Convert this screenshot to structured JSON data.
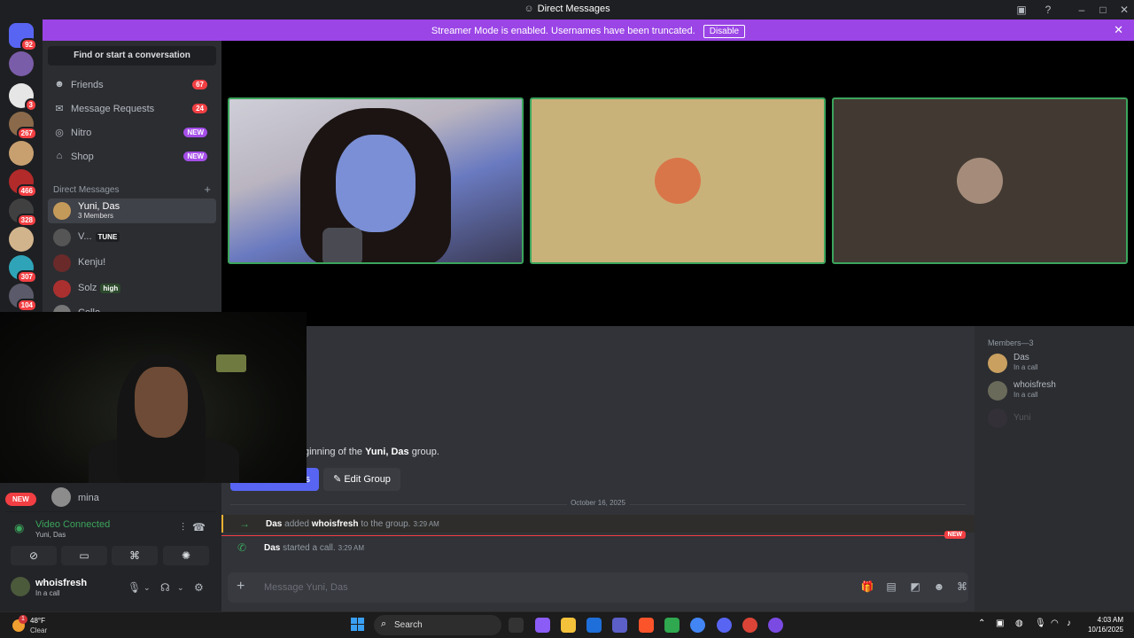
{
  "window": {
    "title": "Direct Messages"
  },
  "banner": {
    "text": "Streamer Mode is enabled. Usernames have been truncated.",
    "button": "Disable"
  },
  "servers": [
    {
      "name": "discord-home",
      "badge": "92",
      "color": "#5865f2"
    },
    {
      "name": "server-1",
      "badge": "",
      "color": "#7a5da8"
    },
    {
      "name": "server-2",
      "badge": "3",
      "color": "#e6e6e6"
    },
    {
      "name": "server-3",
      "badge": "267",
      "color": "#8a6a4a"
    },
    {
      "name": "server-4",
      "badge": "",
      "color": "#c8a070"
    },
    {
      "name": "server-5",
      "badge": "466",
      "color": "#b22a2a"
    },
    {
      "name": "server-6",
      "badge": "328",
      "color": "#404040"
    },
    {
      "name": "server-7",
      "badge": "",
      "color": "#d2b48c"
    },
    {
      "name": "server-8",
      "badge": "307",
      "color": "#2fa4b8"
    },
    {
      "name": "server-9",
      "badge": "104",
      "color": "#5a5a6a"
    }
  ],
  "sidebar": {
    "search_label": "Find or start a conversation",
    "nav": [
      {
        "label": "Friends",
        "badge": "67",
        "icon": "friends-icon"
      },
      {
        "label": "Message Requests",
        "badge": "24",
        "icon": "mail-icon"
      },
      {
        "label": "Nitro",
        "badge": "NEW",
        "icon": "nitro-icon"
      },
      {
        "label": "Shop",
        "badge": "NEW",
        "icon": "shop-icon"
      }
    ],
    "dm_header": "Direct Messages",
    "dms": [
      {
        "name": "Yuni, Das",
        "sub": "3 Members",
        "tag": "",
        "color": "#c49a5a"
      },
      {
        "name": "V...",
        "sub": "",
        "tag": "TUNE",
        "color": "#555"
      },
      {
        "name": "Kenju!",
        "sub": "",
        "tag": "",
        "color": "#6a2a2a"
      },
      {
        "name": "Solz",
        "sub": "",
        "tag": "high",
        "color": "#aa3030"
      },
      {
        "name": "Cello",
        "sub": "",
        "tag": "",
        "color": "#777"
      }
    ],
    "mina": "mina",
    "new_pill": "NEW"
  },
  "voice": {
    "status": "Video Connected",
    "channel": "Yuni, Das"
  },
  "user": {
    "name": "whoisfresh",
    "status": "In a call"
  },
  "call": {
    "tiles": [
      {
        "bg": "#4a5fa8"
      },
      {
        "bg": "#c9b27a",
        "avatar": "#d8764a"
      },
      {
        "bg": "#423a32",
        "avatar": "#a58c7a"
      }
    ]
  },
  "chat": {
    "welcome_title": "s",
    "welcome_prefix": "ginning of the ",
    "welcome_group": "Yuni, Das",
    "welcome_suffix": " group.",
    "invite_button": "s",
    "edit_button": "Edit Group",
    "date": "October 16, 2025",
    "messages": [
      {
        "actor": "Das",
        "verb": "added",
        "target": "whoisfresh",
        "rest": "to the group.",
        "time": "3:29 AM"
      },
      {
        "actor": "Das",
        "verb": "started a call.",
        "target": "",
        "rest": "",
        "time": "3:29 AM"
      }
    ],
    "new_label": "NEW",
    "placeholder": "Message Yuni, Das"
  },
  "members": {
    "header": "Members—3",
    "list": [
      {
        "name": "Das",
        "status": "In a call",
        "color": "#c9a060"
      },
      {
        "name": "whoisfresh",
        "status": "In a call",
        "color": "#6a6a5a"
      },
      {
        "name": "Yuni",
        "status": "",
        "color": "#4a3a4a"
      }
    ]
  },
  "taskbar": {
    "weather_temp": "48°F",
    "weather_text": "Clear",
    "notif_count": "1",
    "search": "Search",
    "time": "4:03 AM",
    "date": "10/16/2025"
  }
}
